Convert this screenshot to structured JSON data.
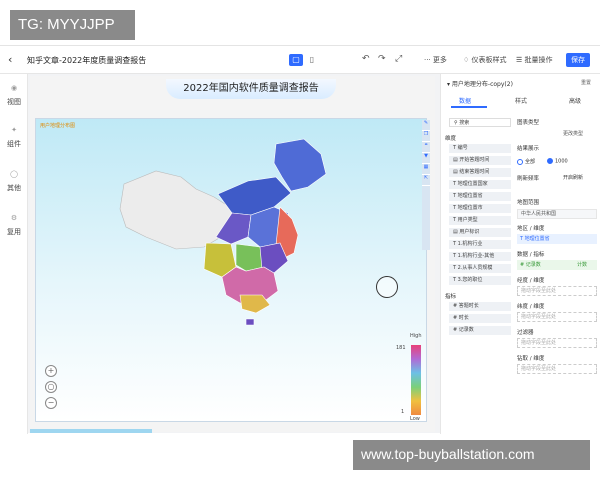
{
  "watermarks": {
    "top": "TG: MYYJJPP",
    "bottom": "www.top-buyballstation.com"
  },
  "toolbar": {
    "doc_title": "知乎文章-2022年度质量调查报告",
    "more": "更多",
    "style_btn": "仪表板样式",
    "batch_btn": "批量操作",
    "save": "保存"
  },
  "left_nav": [
    {
      "icon": "eye-icon",
      "label": "视图"
    },
    {
      "icon": "component-icon",
      "label": "组件"
    },
    {
      "icon": "other-icon",
      "label": "其他"
    },
    {
      "icon": "reuse-icon",
      "label": "复用"
    }
  ],
  "canvas": {
    "report_title": "2022年国内软件质量调查报告",
    "map_label": "用户地理分布图",
    "legend_high": "High",
    "legend_low": "Low",
    "legend_max": "181",
    "legend_min": "1"
  },
  "panel": {
    "header": "用户地理分布-copy(2)",
    "reset": "重置",
    "tabs": [
      "数据",
      "样式",
      "高级"
    ],
    "search_placeholder": "搜索",
    "dim_label": "维度",
    "dims": [
      "编号",
      "开始答题时间",
      "结束答题时间",
      "地理位置国家",
      "地理位置省",
      "地理位置市",
      "用户类型",
      "用户标识",
      "1.机构行业",
      "1.机构行业-其他",
      "2.从事人员规模",
      "3.您的职位"
    ],
    "measure_label": "指标",
    "measures": [
      "答题时长",
      "时长",
      "记录数"
    ],
    "chart_type_label": "图表类型",
    "chart_type_value": "更改类型",
    "result_label": "结果展示",
    "result_all": "全部",
    "result_count": "1000",
    "refresh_label": "刷新频率",
    "refresh_toggle": "开启刷新",
    "map_range_label": "地图范围",
    "map_range_value": "中华人民共和国",
    "region_label": "地区 / 维度",
    "region_chip": "地理位置省",
    "data_label": "数据 / 指标",
    "data_chip": "记录数",
    "data_chip_agg": "计数",
    "lng_label": "经度 / 维度",
    "lat_label": "纬度 / 维度",
    "filter_label": "过滤器",
    "drill_label": "钻取 / 维度",
    "drop_hint": "拖动字段至此处"
  }
}
